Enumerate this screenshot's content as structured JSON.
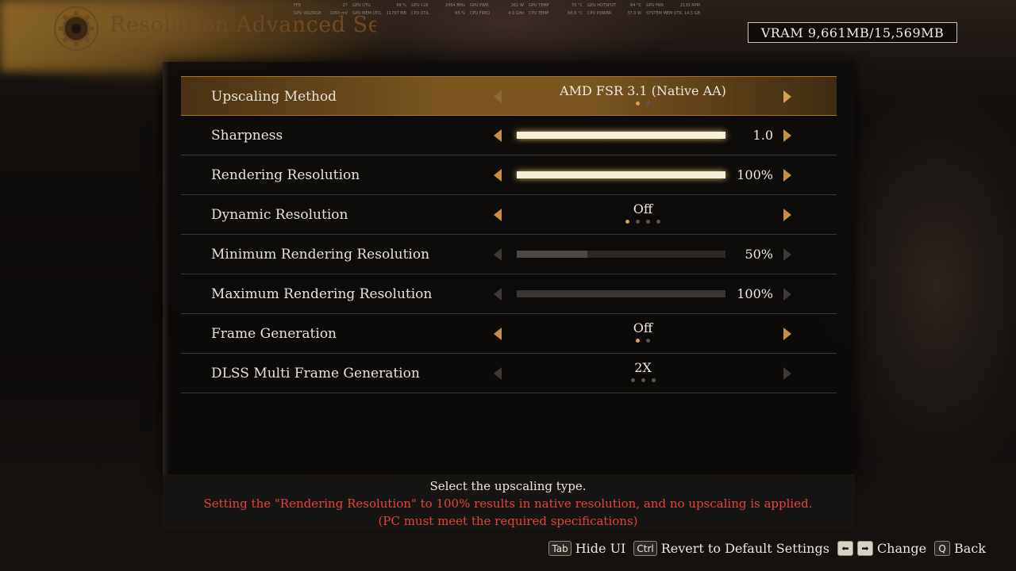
{
  "header": {
    "title": "Resolution Advanced Settin"
  },
  "perf_overlay": {
    "row1": [
      {
        "label": "FPS",
        "value": "27"
      },
      {
        "label": "GPU UTIL",
        "value": "99 %"
      },
      {
        "label": "GPU CLK",
        "value": "2454 MHz"
      },
      {
        "label": "GPU PWR",
        "value": "261 W"
      },
      {
        "label": "GPU TEMP",
        "value": "70 °C"
      },
      {
        "label": "GPU HOTSPOT",
        "value": "84 °C"
      },
      {
        "label": "GPU FAN",
        "value": "2130 RPM"
      }
    ],
    "row2": [
      {
        "label": "GPU VOLTAGE",
        "value": "1050 mV"
      },
      {
        "label": "GPU MEM UTIL",
        "value": "11797 MB"
      },
      {
        "label": "CPU UTIL",
        "value": "65 %"
      },
      {
        "label": "CPU FREQ",
        "value": "4.0 GHz"
      },
      {
        "label": "CPU TEMP",
        "value": "60.6 °C"
      },
      {
        "label": "CPU POWER",
        "value": "37.0 W"
      },
      {
        "label": "SYSTEM MEM UTIL",
        "value": "14.5 GB"
      }
    ]
  },
  "vram": {
    "label": "VRAM 9,661MB/15,569MB"
  },
  "settings": [
    {
      "label": "Upscaling Method",
      "value": "AMD FSR 3.1 (Native AA)"
    },
    {
      "label": "Sharpness",
      "value": "1.0",
      "level": 1.0
    },
    {
      "label": "Rendering Resolution",
      "value": "100%",
      "level": 1.0
    },
    {
      "label": "Dynamic Resolution",
      "value": "Off"
    },
    {
      "label": "Minimum Rendering Resolution",
      "value": "50%",
      "level": 0.34
    },
    {
      "label": "Maximum Rendering Resolution",
      "value": "100%",
      "level": 1.0
    },
    {
      "label": "Frame Generation",
      "value": "Off"
    },
    {
      "label": "DLSS Multi Frame Generation",
      "value": "2X"
    }
  ],
  "description": {
    "line1": "Select the upscaling type.",
    "line2": "Setting the \"Rendering Resolution\" to 100% results in native resolution, and no upscaling is applied.",
    "line3": "(PC must meet the required specifications)"
  },
  "hints": {
    "tab_key": "Tab",
    "hide_ui": "Hide UI",
    "ctrl_key": "Ctrl",
    "revert": "Revert to Default Settings",
    "left_key": "⬅",
    "right_key": "➡",
    "change": "Change",
    "q_key": "Q",
    "back": "Back"
  },
  "colors": {
    "accent": "#d7a24d",
    "warning": "#e0443b",
    "selected_row": "#a8742a"
  },
  "icons": {
    "emblem": "gear-emblem-icon",
    "arrows": "chevron-left-icon / chevron-right-icon"
  }
}
